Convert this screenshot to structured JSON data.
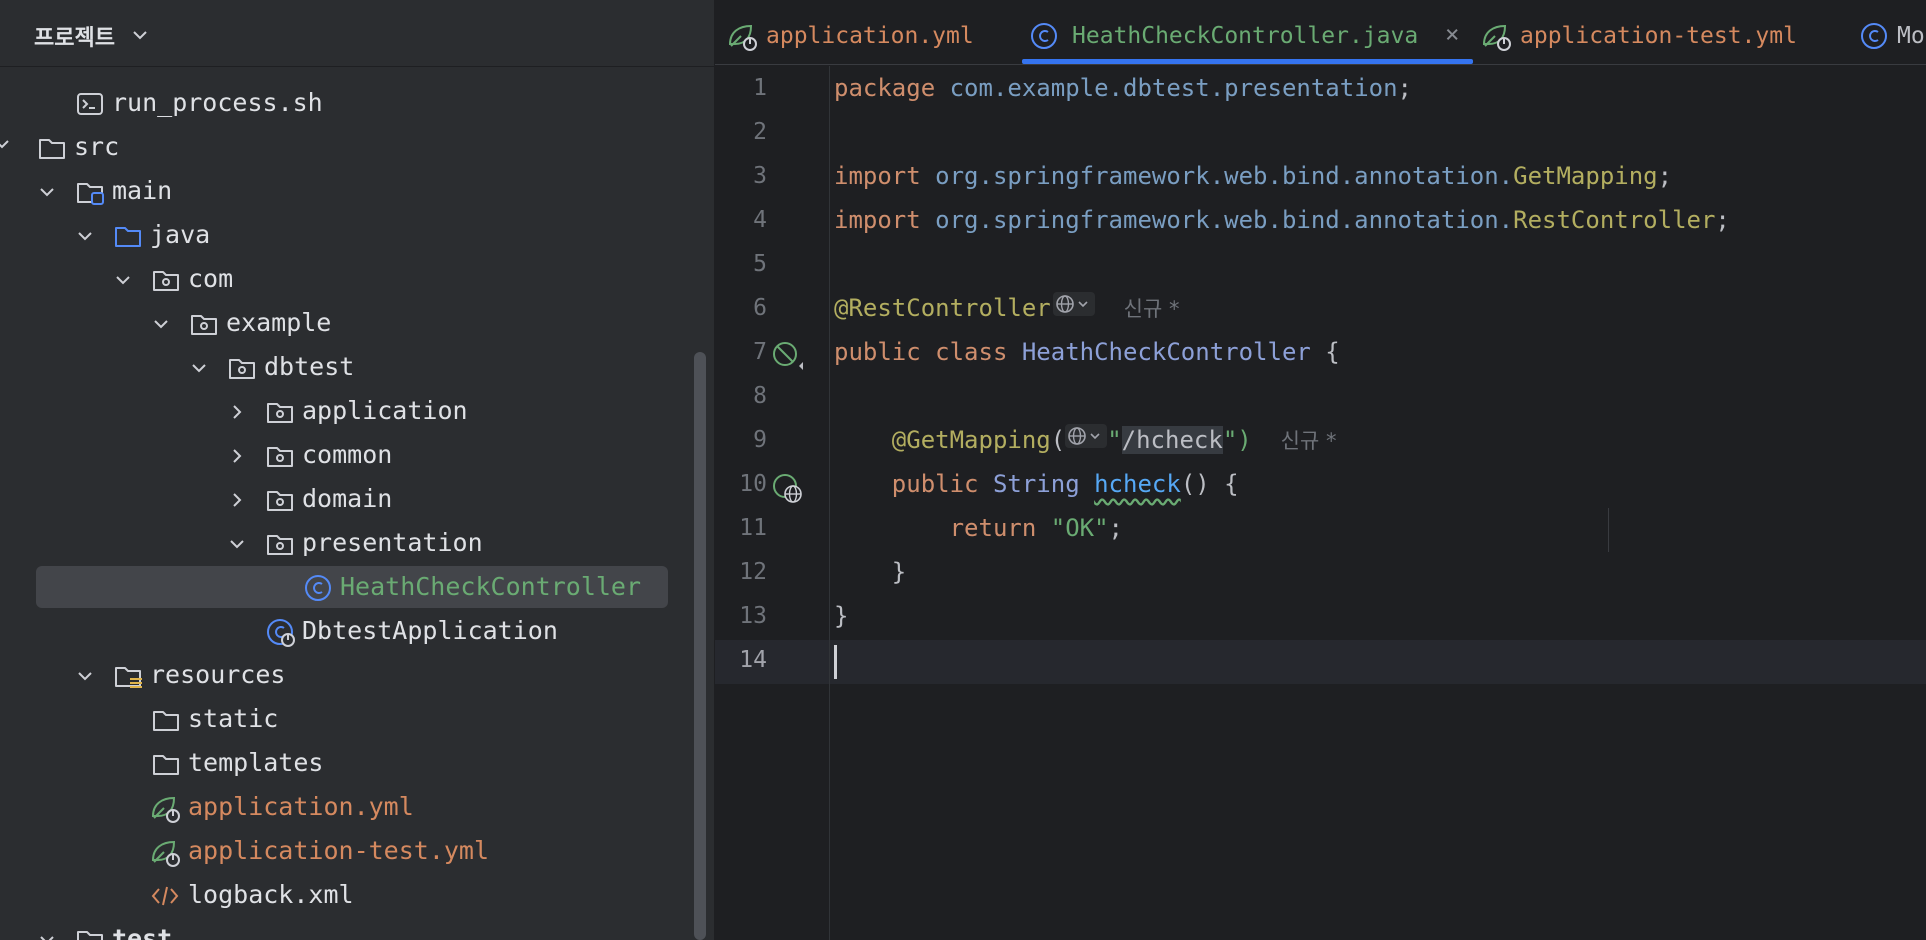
{
  "project_panel": {
    "title": "프로젝트",
    "tree": [
      {
        "label": "run_process.sh",
        "icon": "shell-script-icon",
        "color": "#dfe1e5"
      },
      {
        "label": "src",
        "icon": "folder-icon",
        "color": "#dfe1e5"
      },
      {
        "label": "main",
        "icon": "source-root-folder-icon",
        "color": "#dfe1e5"
      },
      {
        "label": "java",
        "icon": "java-source-folder-icon",
        "color": "#dfe1e5"
      },
      {
        "label": "com",
        "icon": "package-icon",
        "color": "#dfe1e5"
      },
      {
        "label": "example",
        "icon": "package-icon",
        "color": "#dfe1e5"
      },
      {
        "label": "dbtest",
        "icon": "package-icon",
        "color": "#dfe1e5"
      },
      {
        "label": "application",
        "icon": "package-icon",
        "color": "#dfe1e5"
      },
      {
        "label": "common",
        "icon": "package-icon",
        "color": "#dfe1e5"
      },
      {
        "label": "domain",
        "icon": "package-icon",
        "color": "#dfe1e5"
      },
      {
        "label": "presentation",
        "icon": "package-icon",
        "color": "#dfe1e5"
      },
      {
        "label": "HeathCheckController",
        "icon": "java-class-icon",
        "color": "#6aab73"
      },
      {
        "label": "DbtestApplication",
        "icon": "spring-boot-class-icon",
        "color": "#dfe1e5"
      },
      {
        "label": "resources",
        "icon": "resources-folder-icon",
        "color": "#dfe1e5"
      },
      {
        "label": "static",
        "icon": "folder-icon",
        "color": "#dfe1e5"
      },
      {
        "label": "templates",
        "icon": "folder-icon",
        "color": "#dfe1e5"
      },
      {
        "label": "application.yml",
        "icon": "spring-yaml-icon",
        "color": "#d5895f"
      },
      {
        "label": "application-test.yml",
        "icon": "spring-yaml-icon",
        "color": "#d5895f"
      },
      {
        "label": "logback.xml",
        "icon": "xml-icon",
        "color": "#dfe1e5"
      },
      {
        "label": "test",
        "icon": "folder-icon",
        "color": "#dfe1e5"
      }
    ]
  },
  "editor": {
    "tabs": [
      {
        "label": "application.yml",
        "icon": "spring-yaml-icon",
        "active": false
      },
      {
        "label": "HeathCheckController.java",
        "icon": "java-class-icon",
        "active": true
      },
      {
        "label": "application-test.yml",
        "icon": "spring-yaml-icon",
        "active": false
      },
      {
        "label": "Mo",
        "icon": "java-class-icon",
        "active": false
      }
    ],
    "close_glyph": "×",
    "line_numbers": [
      "1",
      "2",
      "3",
      "4",
      "5",
      "6",
      "7",
      "8",
      "9",
      "10",
      "11",
      "12",
      "13",
      "14"
    ],
    "code": {
      "l1_kw": "package",
      "l1_pkg": "com.example.dbtest.presentation",
      "semi": ";",
      "import_kw": "import",
      "l3_pkg": "org.springframework.web.bind.annotation.",
      "l3_ann": "GetMapping",
      "l4_pkg": "org.springframework.web.bind.annotation.",
      "l4_ann": "RestController",
      "l6_ann": "@RestController",
      "new_hint": "신규 *",
      "l7_public": "public",
      "l7_class": "class",
      "l7_name": "HeathCheckController",
      "open_brace": "{",
      "close_brace": "}",
      "l9_ann": "@GetMapping",
      "l9_open": "(",
      "l9_q": "\"",
      "l9_path": "/hcheck",
      "l9_close": "\")",
      "l10_public": "public",
      "l10_type": "String",
      "l10_fn": "hcheck",
      "l10_rest": "() {",
      "l11_return": "return",
      "l11_str": "\"OK\"",
      "l11_semi": ";"
    }
  },
  "colors": {
    "accent": "#3574f0",
    "keyword": "#cf8e6d",
    "string": "#6aab73",
    "annotation": "#b3ae60"
  }
}
